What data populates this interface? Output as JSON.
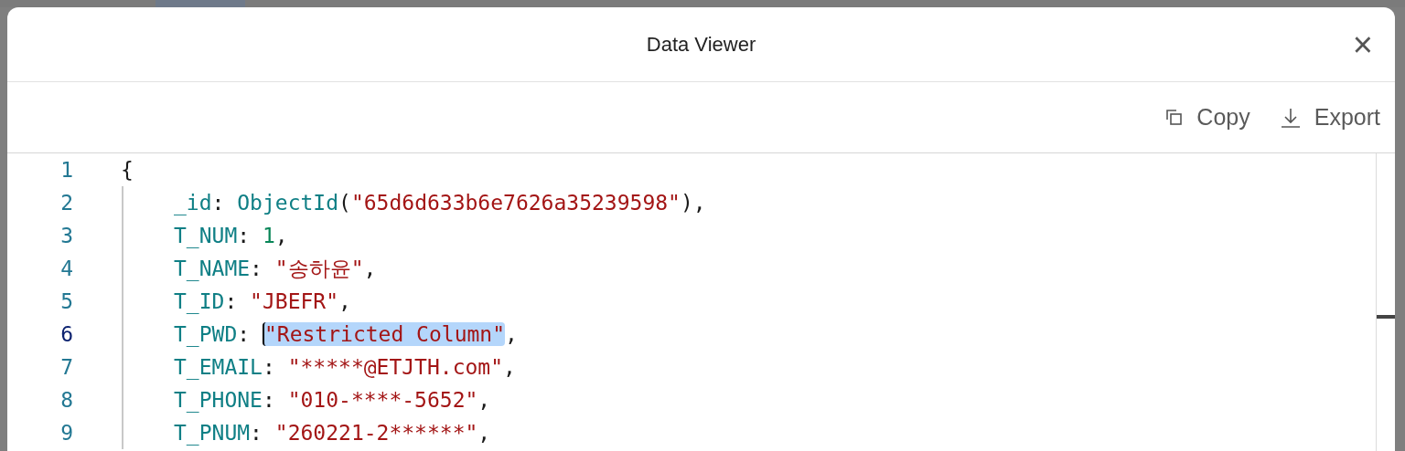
{
  "dialog": {
    "title": "Data Viewer",
    "close": "×"
  },
  "toolbar": [
    {
      "kind": "copy",
      "label": "Copy"
    },
    {
      "kind": "export",
      "label": "Export"
    }
  ],
  "editor": {
    "lines": [
      {
        "number": "1",
        "active": false,
        "tokens": [
          {
            "kind": "punct",
            "text": "{"
          }
        ],
        "children": [
          {
            "number": "2",
            "active": false,
            "tokens": [
              {
                "kind": "key",
                "text": "_id"
              },
              {
                "kind": "punct",
                "text": ": "
              },
              {
                "kind": "func",
                "text": "ObjectId"
              },
              {
                "kind": "punct",
                "text": "("
              },
              {
                "kind": "string",
                "text": "\"65d6d633b6e7626a35239598\""
              },
              {
                "kind": "punct",
                "text": "),"
              }
            ]
          },
          {
            "number": "3",
            "active": false,
            "tokens": [
              {
                "kind": "key",
                "text": "T_NUM"
              },
              {
                "kind": "punct",
                "text": ": "
              },
              {
                "kind": "number",
                "text": "1"
              },
              {
                "kind": "punct",
                "text": ","
              }
            ]
          },
          {
            "number": "4",
            "active": false,
            "tokens": [
              {
                "kind": "key",
                "text": "T_NAME"
              },
              {
                "kind": "punct",
                "text": ": "
              },
              {
                "kind": "string",
                "text": "\"송하윤\""
              },
              {
                "kind": "punct",
                "text": ","
              }
            ]
          },
          {
            "number": "5",
            "active": false,
            "tokens": [
              {
                "kind": "key",
                "text": "T_ID"
              },
              {
                "kind": "punct",
                "text": ": "
              },
              {
                "kind": "string",
                "text": "\"JBEFR\""
              },
              {
                "kind": "punct",
                "text": ","
              }
            ]
          },
          {
            "number": "6",
            "active": true,
            "tokens": [
              {
                "kind": "key",
                "text": "T_PWD"
              },
              {
                "kind": "punct",
                "text": ": "
              },
              {
                "kind": "string",
                "text": "\"Restricted Column\"",
                "selected": true
              },
              {
                "kind": "punct",
                "text": ","
              }
            ]
          },
          {
            "number": "7",
            "active": false,
            "tokens": [
              {
                "kind": "key",
                "text": "T_EMAIL"
              },
              {
                "kind": "punct",
                "text": ": "
              },
              {
                "kind": "string",
                "text": "\"*****@ETJTH.com\""
              },
              {
                "kind": "punct",
                "text": ","
              }
            ]
          },
          {
            "number": "8",
            "active": false,
            "tokens": [
              {
                "kind": "key",
                "text": "T_PHONE"
              },
              {
                "kind": "punct",
                "text": ": "
              },
              {
                "kind": "string",
                "text": "\"010-****-5652\""
              },
              {
                "kind": "punct",
                "text": ","
              }
            ]
          },
          {
            "number": "9",
            "active": false,
            "tokens": [
              {
                "kind": "key",
                "text": "T_PNUM"
              },
              {
                "kind": "punct",
                "text": ": "
              },
              {
                "kind": "string",
                "text": "\"260221-2******\""
              },
              {
                "kind": "punct",
                "text": ","
              }
            ]
          }
        ]
      }
    ]
  }
}
